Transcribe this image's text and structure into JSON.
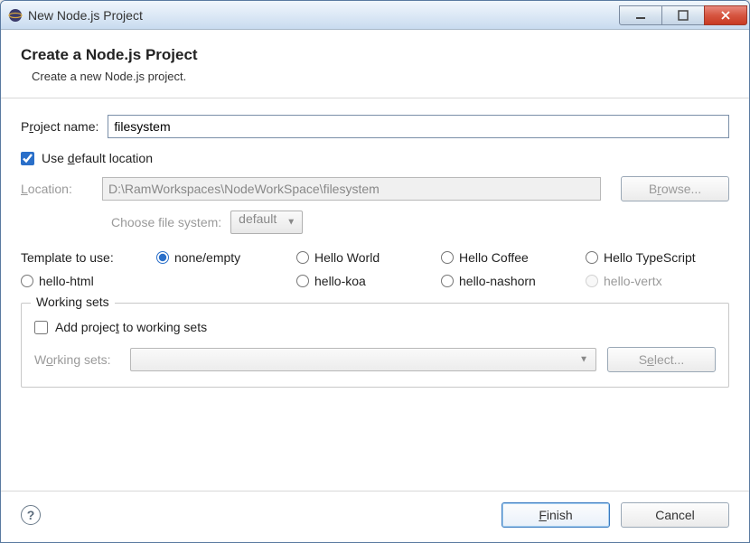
{
  "window": {
    "title": "New Node.js Project"
  },
  "header": {
    "title": "Create a Node.js Project",
    "subtitle": "Create a new Node.js project."
  },
  "project": {
    "name_label_pre": "P",
    "name_label_u": "r",
    "name_label_post": "oject name:",
    "name_value": "filesystem"
  },
  "location": {
    "use_default_pre": "Use ",
    "use_default_u": "d",
    "use_default_post": "efault location",
    "use_default_checked": true,
    "location_label_pre": "",
    "location_label_u": "L",
    "location_label_post": "ocation:",
    "location_value": "D:\\RamWorkspaces\\NodeWorkSpace\\filesystem",
    "browse_label_pre": "B",
    "browse_label_u": "r",
    "browse_label_post": "owse...",
    "filesys_label": "Choose file system:",
    "filesys_value": "default"
  },
  "template": {
    "label": "Template to use:",
    "options": [
      {
        "label": "none/empty",
        "checked": true,
        "disabled": false
      },
      {
        "label": "Hello World",
        "checked": false,
        "disabled": false
      },
      {
        "label": "Hello Coffee",
        "checked": false,
        "disabled": false
      },
      {
        "label": "Hello TypeScript",
        "checked": false,
        "disabled": false
      },
      {
        "label": "hello-html",
        "checked": false,
        "disabled": false
      },
      {
        "label": "hello-koa",
        "checked": false,
        "disabled": false
      },
      {
        "label": "hello-nashorn",
        "checked": false,
        "disabled": false
      },
      {
        "label": "hello-vertx",
        "checked": false,
        "disabled": true
      }
    ]
  },
  "working_sets": {
    "legend": "Working sets",
    "add_label_pre": "Add projec",
    "add_label_u": "t",
    "add_label_post": " to working sets",
    "add_checked": false,
    "sets_label_pre": "W",
    "sets_label_u": "o",
    "sets_label_post": "rking sets:",
    "select_label_pre": "S",
    "select_label_u": "e",
    "select_label_post": "lect..."
  },
  "footer": {
    "finish_pre": "",
    "finish_u": "F",
    "finish_post": "inish",
    "cancel": "Cancel"
  }
}
